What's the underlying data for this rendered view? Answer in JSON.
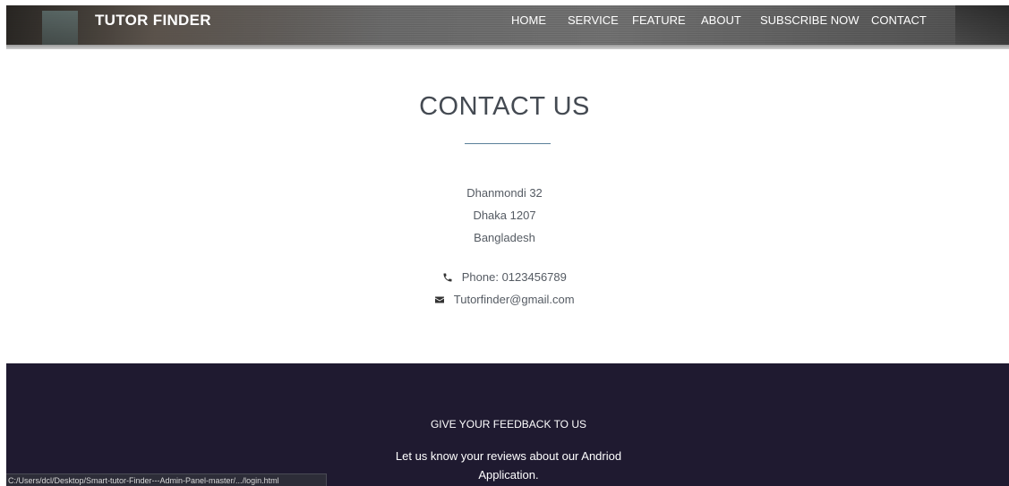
{
  "navbar": {
    "brand": "TUTOR FINDER",
    "links": [
      {
        "label": "HOME"
      },
      {
        "label": "SERVICE"
      },
      {
        "label": "FEATURE"
      },
      {
        "label": "ABOUT"
      },
      {
        "label": "SUBSCRIBE NOW"
      },
      {
        "label": "CONTACT"
      }
    ]
  },
  "contact": {
    "title": "CONTACT US",
    "address": [
      "Dhanmondi 32",
      "Dhaka 1207",
      "Bangladesh"
    ],
    "phone": "Phone: 0123456789",
    "email": "Tutorfinder@gmail.com"
  },
  "footer": {
    "heading": "GIVE YOUR FEEDBACK TO US",
    "text": "Let us know your reviews about our Andriod Application."
  },
  "status_bar": {
    "url": "C:/Users/dcl/Desktop/Smart-tutor-Finder---Admin-Panel-master/.../login.html"
  },
  "colors": {
    "footer_bg": "#1f1a30",
    "title_underline": "#5a7f9a",
    "text": "#555b63"
  },
  "icons": {
    "phone": "phone-icon",
    "email": "envelope-icon"
  }
}
